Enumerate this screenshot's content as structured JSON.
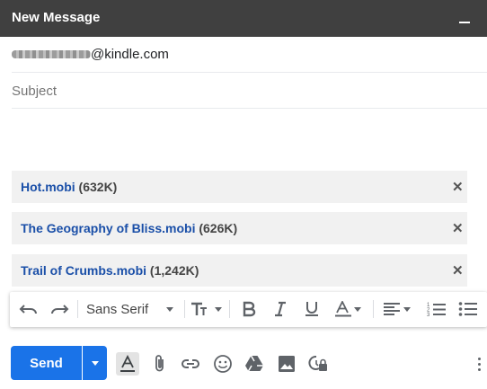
{
  "window": {
    "title": "New Message"
  },
  "compose": {
    "recipient_domain": "@kindle.com",
    "subject_placeholder": "Subject",
    "subject_value": ""
  },
  "attachments": [
    {
      "name": "Hot.mobi",
      "size": "(632K)"
    },
    {
      "name": "The Geography of Bliss.mobi",
      "size": "(626K)"
    },
    {
      "name": "Trail of Crumbs.mobi",
      "size": "(1,242K)"
    }
  ],
  "formatting": {
    "font": "Sans Serif",
    "icons": [
      "undo-icon",
      "redo-icon",
      "font-size-icon",
      "bold-icon",
      "italic-icon",
      "underline-icon",
      "text-color-icon",
      "align-icon",
      "numbered-list-icon",
      "bulleted-list-icon"
    ]
  },
  "bottom_toolbar": {
    "send_label": "Send",
    "icons": [
      "formatting-options-icon",
      "attach-file-icon",
      "insert-link-icon",
      "emoji-icon",
      "google-drive-icon",
      "insert-photo-icon",
      "confidential-mode-icon",
      "more-options-icon"
    ]
  },
  "colors": {
    "title_bar": "#404040",
    "send_button": "#1a73e8",
    "attachment_link": "#1a4fa8",
    "attachment_bg": "#f1f1f1"
  }
}
